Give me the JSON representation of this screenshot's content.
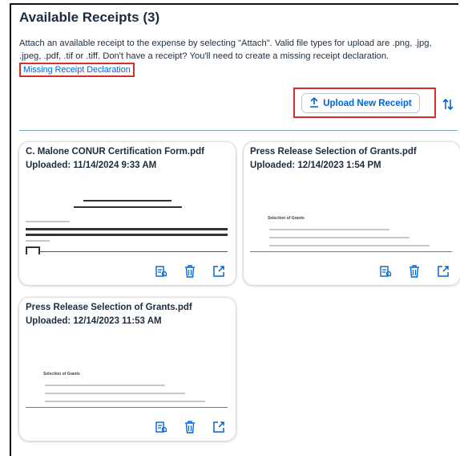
{
  "header": {
    "title": "Available Receipts (3)",
    "description": "Attach an available receipt to the expense by selecting \"Attach\". Valid file types for upload are .png, .jpg, .jpeg, .pdf, .tif or .tiff.   Don't have a receipt? You'll need to create a missing receipt declaration.",
    "missing_link": "Missing Receipt Declaration"
  },
  "toolbar": {
    "upload_label": "Upload New Receipt",
    "upload_icon": "upload-icon",
    "sort_icon": "sort-icon"
  },
  "receipts": [
    {
      "name": "C. Malone CONUR Certification Form.pdf",
      "uploaded": "Uploaded: 11/14/2024 9:33 AM",
      "preview_heading": ""
    },
    {
      "name": "Press Release Selection of Grants.pdf",
      "uploaded": "Uploaded: 12/14/2023 1:54 PM",
      "preview_heading": "Selection of Grants"
    },
    {
      "name": "Press Release Selection of Grants.pdf",
      "uploaded": "Uploaded: 12/14/2023 11:53 AM",
      "preview_heading": "Selection of Grants"
    }
  ],
  "card_actions": [
    "view-receipt-icon",
    "delete-icon",
    "attach-icon"
  ],
  "colors": {
    "accent": "#0064d9",
    "text": "#1d2d3e",
    "highlight": "#d32f2f",
    "divider": "#7aa7b9"
  }
}
